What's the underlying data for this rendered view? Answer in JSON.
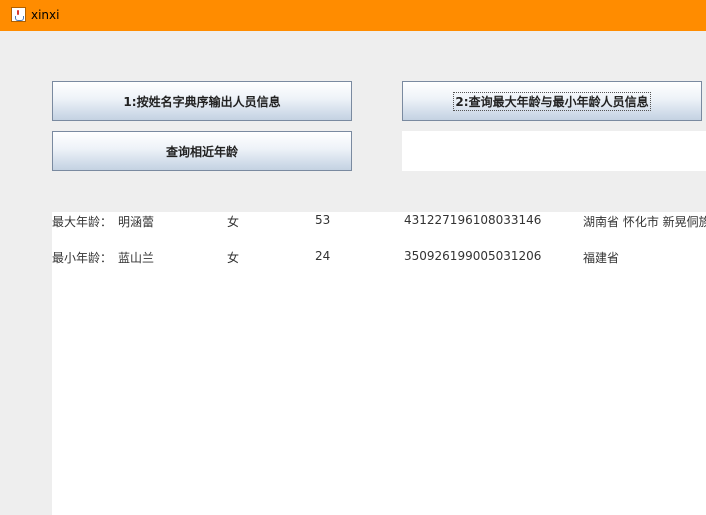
{
  "window": {
    "title": "xinxi"
  },
  "buttons": {
    "sort_by_name": "1:按姓名字典序输出人员信息",
    "query_max_min_age": "2:查询最大年龄与最小年龄人员信息",
    "query_similar_age": "查询相近年龄"
  },
  "input": {
    "value": ""
  },
  "results": [
    {
      "label": "最大年龄：",
      "name": "明涵蕾",
      "sex": "女",
      "age": "53",
      "id_number": "431227196108033146",
      "address": "湖南省 怀化市 新晃侗族"
    },
    {
      "label": "最小年龄：",
      "name": "蓝山兰",
      "sex": "女",
      "age": "24",
      "id_number": "350926199005031206",
      "address": "福建省"
    }
  ],
  "colors": {
    "titlebar": "#ff8c00",
    "background": "#eeeeee"
  },
  "icons": {
    "app": "java-cup-icon"
  }
}
